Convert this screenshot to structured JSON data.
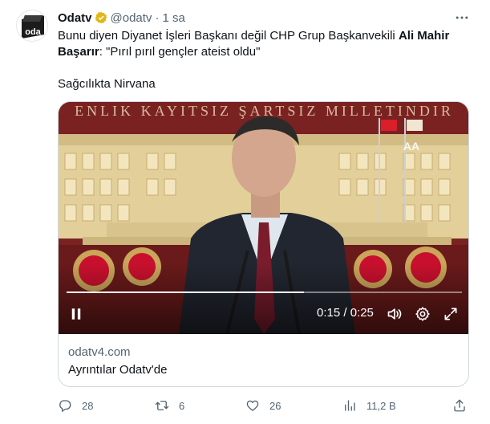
{
  "tweet": {
    "author_name": "Odatv",
    "handle": "@odatv",
    "separator": "·",
    "time": "1 sa",
    "avatar_text": "oda",
    "text_line1_a": "Bunu diyen Diyanet İşleri Başkanı değil CHP Grup Başkanvekili ",
    "text_line1_b": "Ali Mahir",
    "text_line2_a": "Başarır",
    "text_line2_b": ": \"Pırıl pırıl gençler ateist oldu\"",
    "text_line3": "Sağcılıkta Nirvana"
  },
  "video": {
    "banner_text": "ENLIK KAYITSIZ ŞARTSIZ MILLETINDIR",
    "watermark": "AA",
    "time_readout": "0:15 / 0:25",
    "progress_fraction": 0.6
  },
  "card": {
    "domain": "odatv4.com",
    "title": "Ayrıntılar Odatv'de"
  },
  "actions": {
    "replies": "28",
    "retweets": "6",
    "likes": "26",
    "views": "11,2 B"
  },
  "colors": {
    "verified_badge": "#e2b719",
    "secondary_text": "#536471",
    "video_bg": "#6b1d1d"
  },
  "icons": {
    "more": "more-dots-icon",
    "reply": "reply-icon",
    "retweet": "retweet-icon",
    "like": "heart-icon",
    "views": "views-chart-icon",
    "share": "share-icon",
    "play": "pause-icon",
    "volume": "volume-icon",
    "settings": "gear-icon",
    "fullscreen": "fullscreen-icon"
  }
}
